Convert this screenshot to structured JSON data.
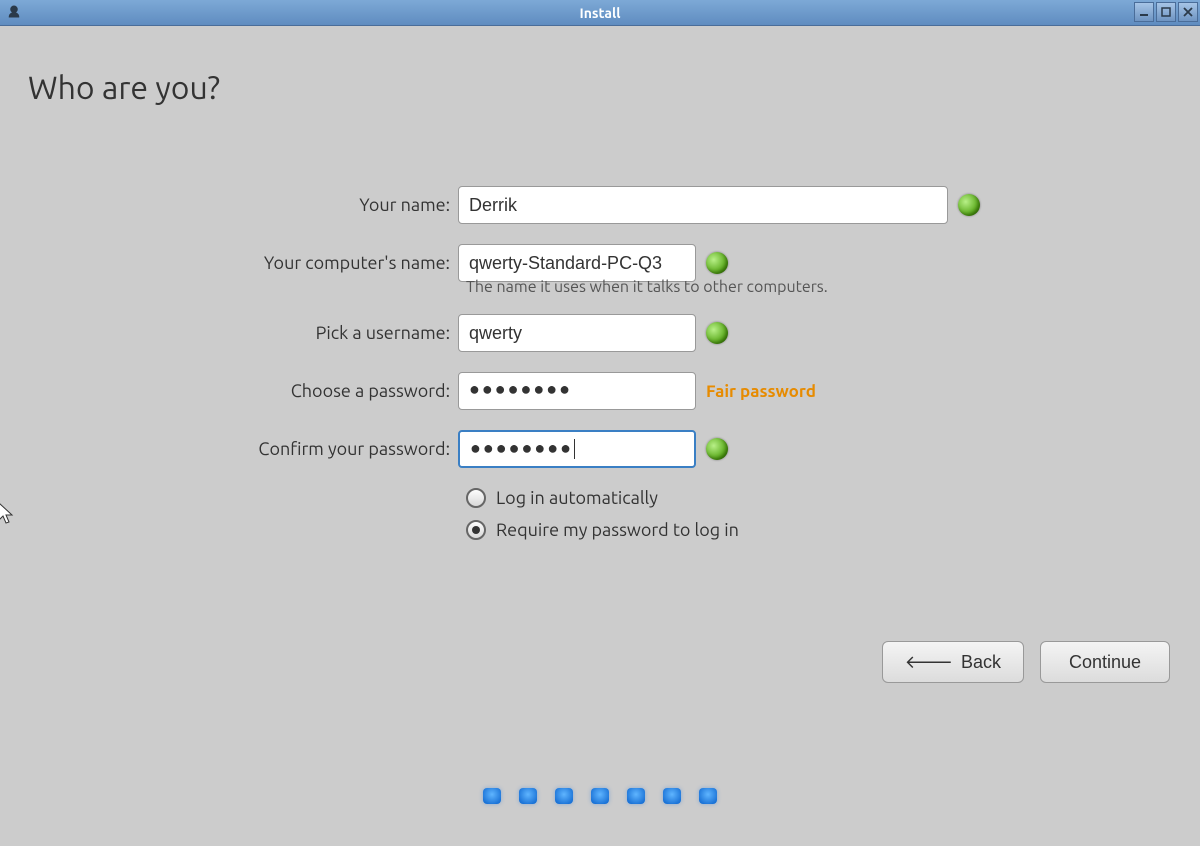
{
  "window": {
    "title": "Install"
  },
  "page": {
    "heading": "Who are you?"
  },
  "form": {
    "name": {
      "label": "Your name:",
      "value": "Derrik"
    },
    "hostname": {
      "label": "Your computer's name:",
      "value": "qwerty-Standard-PC-Q3",
      "hint": "The name it uses when it talks to other computers."
    },
    "username": {
      "label": "Pick a username:",
      "value": "qwerty"
    },
    "password": {
      "label": "Choose a password:",
      "mask": "●●●●●●●●",
      "strength_text": "Fair password"
    },
    "confirm": {
      "label": "Confirm your password:",
      "mask": "●●●●●●●●"
    },
    "login_option": {
      "auto_label": "Log in automatically",
      "require_label": "Require my password to log in",
      "selected": "require"
    }
  },
  "buttons": {
    "back": "Back",
    "continue": "Continue"
  },
  "progress": {
    "total_dots": 7
  }
}
